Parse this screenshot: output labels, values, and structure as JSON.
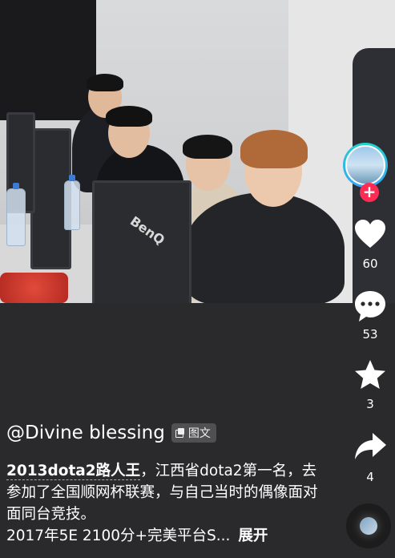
{
  "post": {
    "author": "@Divine blessing",
    "type_tag": "图文",
    "hashtag": "2013dota2路人王",
    "caption_rest": "，江西省dota2第一名，去参加了全国顺网杯联赛，与自己当时的偶像面对面同台竞技。",
    "caption_line4": "2017年5E 2100分+完美平台S...",
    "expand_label": "展开"
  },
  "photo": {
    "monitor_brand": "BenQ"
  },
  "actions": {
    "follow_symbol": "+",
    "likes": "60",
    "comments": "53",
    "favorites": "3",
    "shares": "4"
  },
  "colors": {
    "background": "#2a2a2c",
    "follow": "#fe2c55",
    "avatar_ring": "#21d4c8"
  }
}
